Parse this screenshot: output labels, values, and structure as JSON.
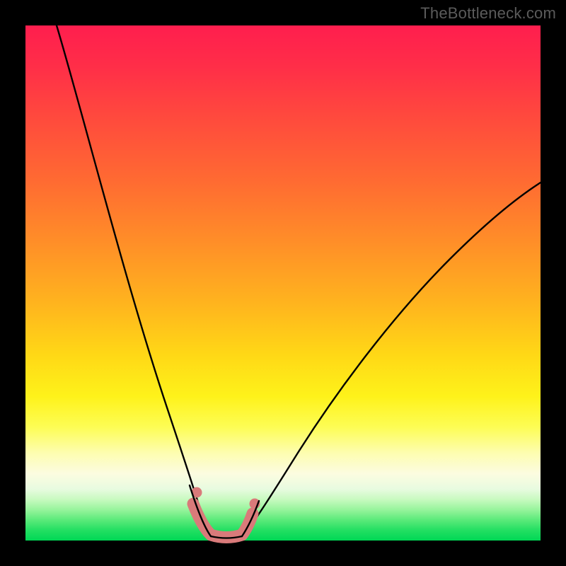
{
  "watermark": "TheBottleneck.com",
  "colors": {
    "frame_bg": "#000000",
    "curve": "#000000",
    "marker_fill": "#d97a7a",
    "marker_stroke": "#c26060",
    "gradient_top": "#ff1e4e",
    "gradient_bottom": "#00d755"
  },
  "chart_data": {
    "type": "line",
    "title": "",
    "xlabel": "",
    "ylabel": "",
    "xlim": [
      0,
      100
    ],
    "ylim": [
      0,
      100
    ],
    "grid": false,
    "note": "y represents bottleneck percentage (top=100=bad/red, bottom=0=good/green); x is an unlabeled component-balance axis. Values are read off the plot by vertical position within the gradient area.",
    "series": [
      {
        "name": "left-branch",
        "x": [
          6,
          8,
          10,
          12,
          14,
          16,
          18,
          20,
          22,
          24,
          26,
          28,
          30,
          32,
          33,
          34,
          35
        ],
        "y": [
          100,
          93,
          86,
          79,
          72,
          65,
          58,
          51,
          44,
          37,
          30,
          23,
          16,
          9,
          5,
          2,
          0.5
        ]
      },
      {
        "name": "right-branch",
        "x": [
          42,
          44,
          46,
          48,
          52,
          56,
          60,
          64,
          68,
          72,
          76,
          80,
          84,
          88,
          92,
          96,
          100
        ],
        "y": [
          0.5,
          3,
          6,
          10,
          17,
          24,
          30,
          35,
          40,
          45,
          49,
          53,
          57,
          60,
          63,
          66,
          69
        ]
      },
      {
        "name": "valley-floor",
        "x": [
          35,
          36,
          37,
          38,
          39,
          40,
          41,
          42
        ],
        "y": [
          0.5,
          0.2,
          0.1,
          0.1,
          0.1,
          0.1,
          0.2,
          0.5
        ]
      }
    ],
    "markers": {
      "name": "highlighted-region",
      "shape": "rounded-capsule",
      "color": "#d97a7a",
      "points_x": [
        32.2,
        33.5,
        35.0,
        37.0,
        39.0,
        41.0,
        42.5,
        43.4
      ],
      "points_y": [
        7.0,
        3.5,
        1.0,
        0.4,
        0.4,
        0.8,
        2.5,
        5.5
      ]
    }
  }
}
